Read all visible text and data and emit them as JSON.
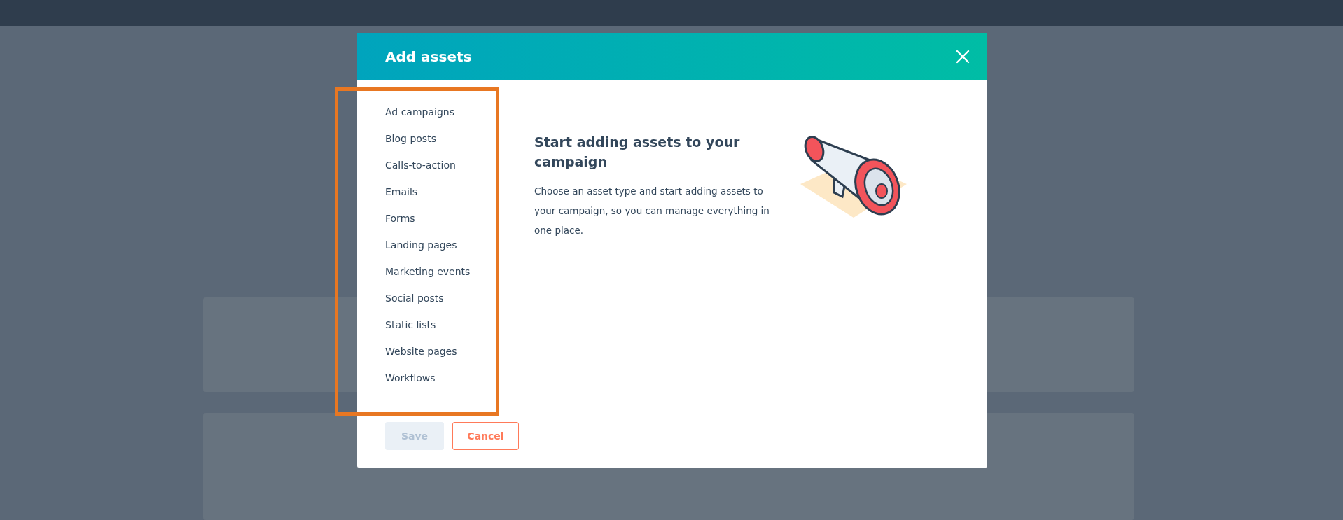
{
  "dialog": {
    "title": "Add assets",
    "asset_types": [
      "Ad campaigns",
      "Blog posts",
      "Calls-to-action",
      "Emails",
      "Forms",
      "Landing pages",
      "Marketing events",
      "Social posts",
      "Static lists",
      "Website pages",
      "Workflows"
    ],
    "empty_state": {
      "heading": "Start adding assets to your campaign",
      "description": "Choose an asset type and start adding assets to your campaign, so you can manage everything in one place."
    },
    "buttons": [
      {
        "label": "Save",
        "kind": "primary",
        "disabled": true
      },
      {
        "label": "Cancel",
        "kind": "secondary",
        "disabled": false
      }
    ]
  }
}
